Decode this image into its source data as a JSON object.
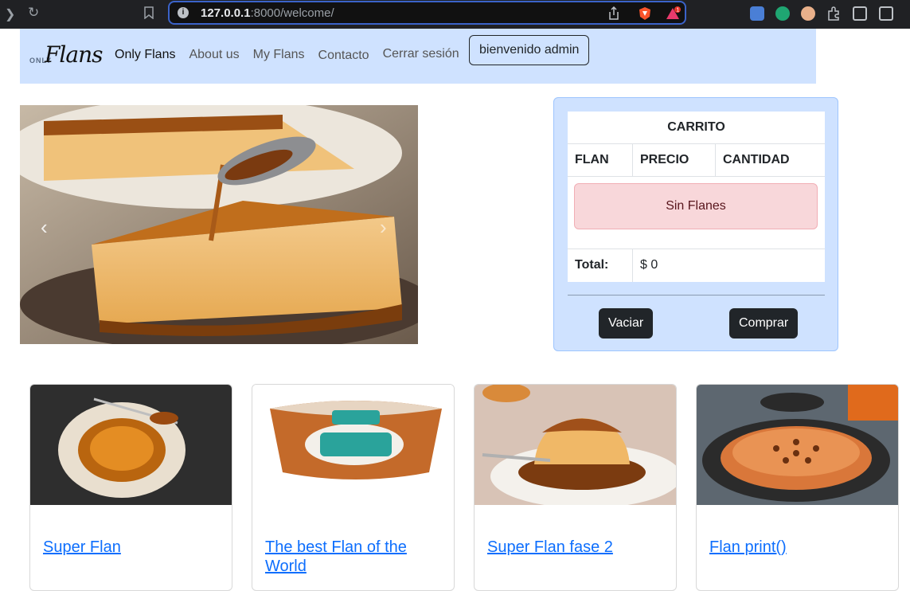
{
  "browser": {
    "url_host": "127.0.0.1",
    "url_rest": ":8000/welcome/"
  },
  "navbar": {
    "brand_small": "ONLY",
    "brand_script": "Flans",
    "links": [
      "Only Flans",
      "About us",
      "My Flans",
      "Contacto",
      "Cerrar sesión"
    ],
    "welcome_label": "bienvenido admin"
  },
  "cart": {
    "title": "CARRITO",
    "columns": [
      "FLAN",
      "PRECIO",
      "CANTIDAD"
    ],
    "empty_message": "Sin Flanes",
    "total_label": "Total:",
    "total_value": "$ 0",
    "empty_button": "Vaciar",
    "buy_button": "Comprar"
  },
  "cards": [
    {
      "title": "Super Flan"
    },
    {
      "title": "The best Flan of the World"
    },
    {
      "title": "Super Flan fase 2"
    },
    {
      "title": "Flan print()"
    }
  ],
  "colors": {
    "navbar_bg": "#cfe2ff",
    "link_blue": "#0d6efd",
    "alert_bg": "#f8d7da",
    "dark_btn": "#212529"
  }
}
